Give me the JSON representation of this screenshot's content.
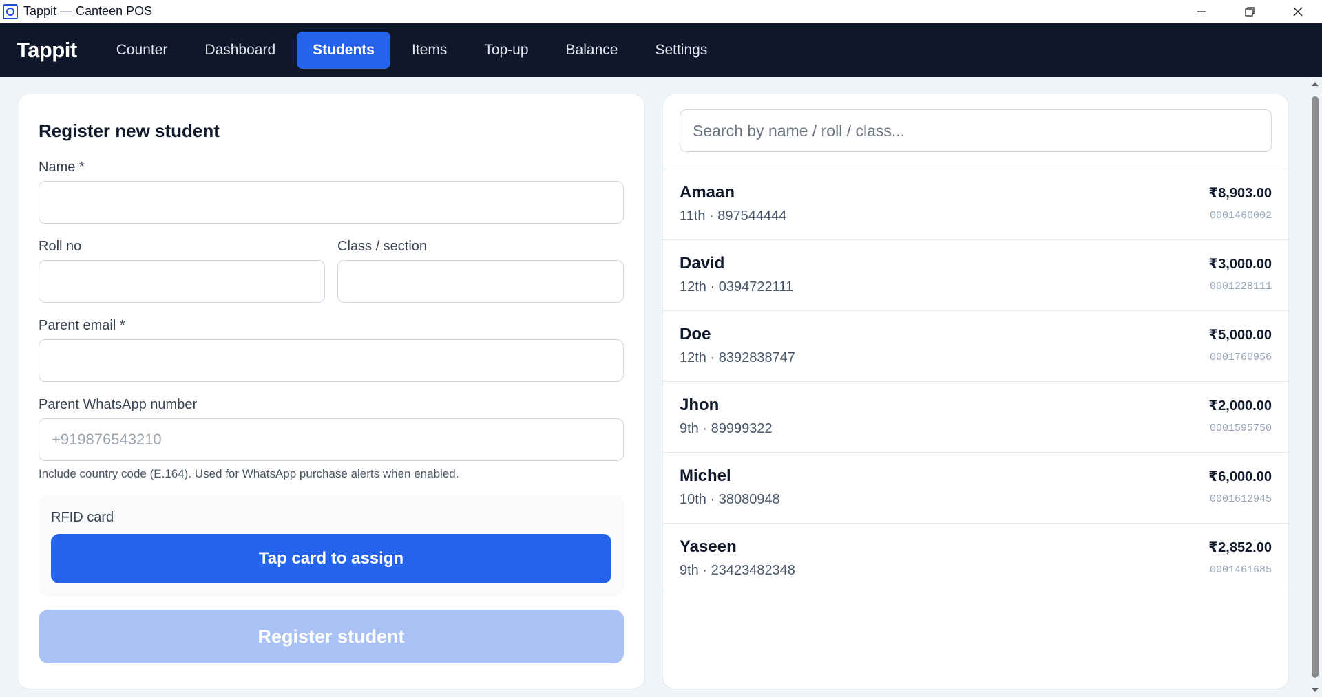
{
  "window": {
    "title": "Tappit — Canteen POS"
  },
  "nav": {
    "brand": "Tappit",
    "items": [
      {
        "label": "Counter",
        "active": false
      },
      {
        "label": "Dashboard",
        "active": false
      },
      {
        "label": "Students",
        "active": true
      },
      {
        "label": "Items",
        "active": false
      },
      {
        "label": "Top-up",
        "active": false
      },
      {
        "label": "Balance",
        "active": false
      },
      {
        "label": "Settings",
        "active": false
      }
    ]
  },
  "form": {
    "title": "Register new student",
    "name_label": "Name *",
    "name_value": "",
    "roll_label": "Roll no",
    "roll_value": "",
    "class_label": "Class / section",
    "class_value": "",
    "email_label": "Parent email *",
    "email_value": "",
    "whatsapp_label": "Parent WhatsApp number",
    "whatsapp_placeholder": "+919876543210",
    "whatsapp_hint": "Include country code (E.164). Used for WhatsApp purchase alerts when enabled.",
    "rfid_label": "RFID card",
    "tap_button": "Tap card to assign",
    "register_button": "Register student"
  },
  "search": {
    "placeholder": "Search by name / roll / class..."
  },
  "students": [
    {
      "name": "Amaan",
      "meta": "11th · 897544444",
      "balance": "₹8,903.00",
      "card": "0001460002"
    },
    {
      "name": "David",
      "meta": "12th · 0394722111",
      "balance": "₹3,000.00",
      "card": "0001228111"
    },
    {
      "name": "Doe",
      "meta": "12th · 8392838747",
      "balance": "₹5,000.00",
      "card": "0001760956"
    },
    {
      "name": "Jhon",
      "meta": "9th · 89999322",
      "balance": "₹2,000.00",
      "card": "0001595750"
    },
    {
      "name": "Michel",
      "meta": "10th · 38080948",
      "balance": "₹6,000.00",
      "card": "0001612945"
    },
    {
      "name": "Yaseen",
      "meta": "9th · 23423482348",
      "balance": "₹2,852.00",
      "card": "0001461685"
    }
  ],
  "colors": {
    "nav_bg": "#0f172a",
    "accent": "#2563eb",
    "disabled_button": "#a9c1f5"
  }
}
